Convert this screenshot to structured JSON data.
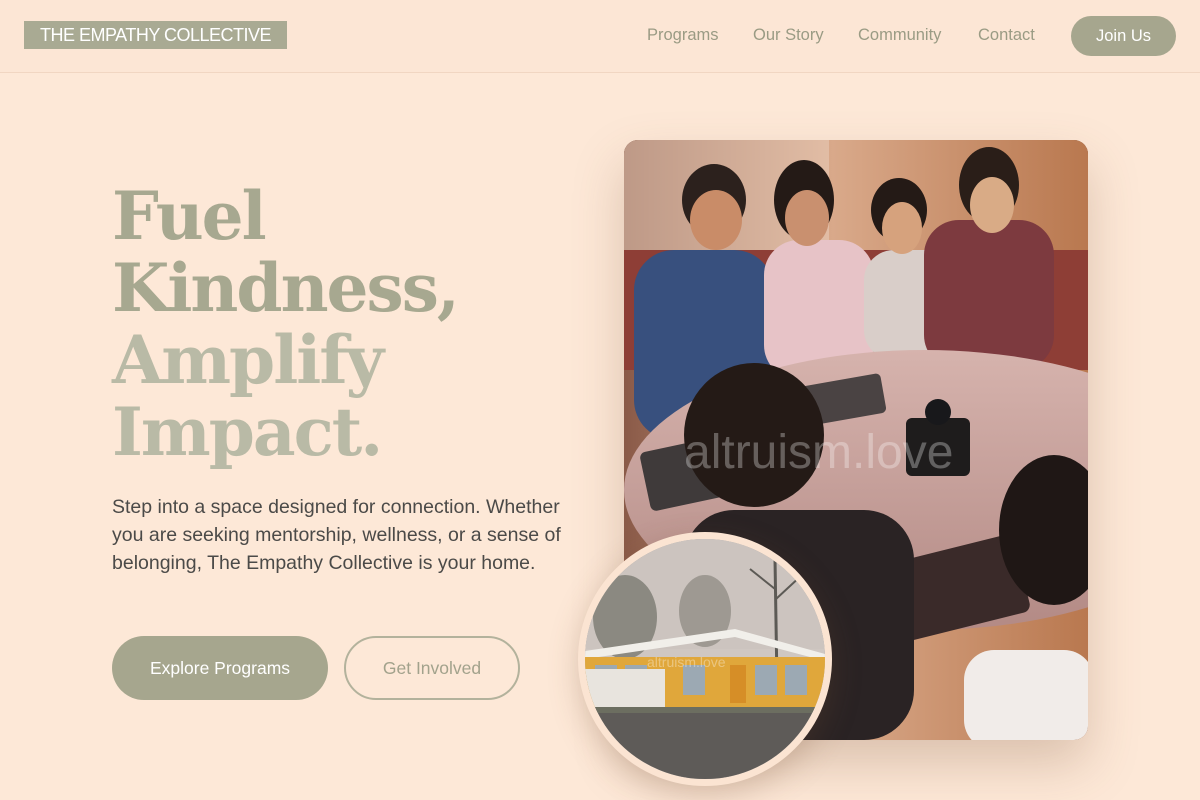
{
  "header": {
    "brand": "THE EMPATHY COLLECTIVE",
    "nav": [
      "Programs",
      "Our Story",
      "Community",
      "Contact"
    ],
    "cta": "Join Us"
  },
  "hero": {
    "headline_lines": [
      "Fuel",
      "Kindness,",
      "Amplify",
      "Impact."
    ],
    "intro": "Step into a space designed for connection. Whether you are seeking mentorship, wellness, or a sense of belonging, The Empathy Collective is your home.",
    "primary_button": "Explore Programs",
    "secondary_button": "Get Involved"
  },
  "images": {
    "main_watermark": "altruism.love",
    "inset_watermark": "altruism.love"
  },
  "colors": {
    "background": "#fde8d7",
    "accent": "#a6a68e",
    "headline_light": "#b9baa6",
    "body_text": "#4b4a48"
  }
}
